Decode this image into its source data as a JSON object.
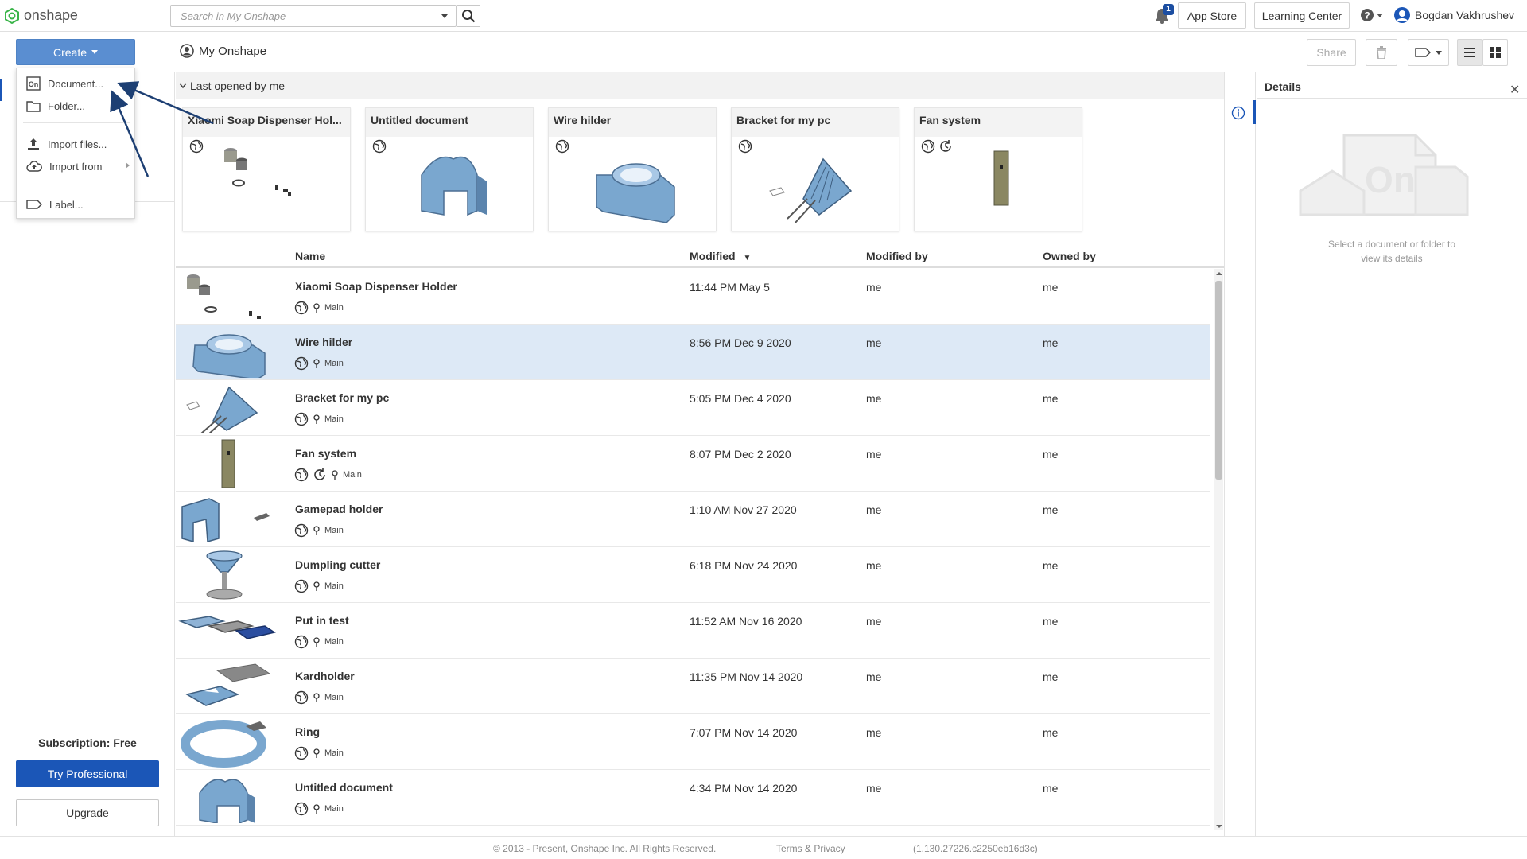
{
  "app": {
    "logo_text": "onshape"
  },
  "search": {
    "placeholder": "Search in My Onshape"
  },
  "notifications": {
    "count": "1"
  },
  "top_buttons": {
    "app_store": "App Store",
    "learning_center": "Learning Center"
  },
  "user": {
    "name": "Bogdan Vakhrushev"
  },
  "toolbar": {
    "create_label": "Create",
    "share_label": "Share"
  },
  "breadcrumb": {
    "label": "My Onshape"
  },
  "create_menu": [
    {
      "label": "Document...",
      "icon": "onshape-doc-icon"
    },
    {
      "label": "Folder...",
      "icon": "folder-icon"
    },
    {
      "label": "Import files...",
      "icon": "upload-icon"
    },
    {
      "label": "Import from",
      "icon": "cloud-upload-icon",
      "has_submenu": true
    },
    {
      "label": "Label...",
      "icon": "label-icon"
    }
  ],
  "recent": {
    "header": "Last opened by me",
    "cards": [
      {
        "title": "Xiaomi Soap Dispenser Hol...",
        "icons": [
          "globe"
        ]
      },
      {
        "title": "Untitled document",
        "icons": [
          "globe"
        ]
      },
      {
        "title": "Wire hilder",
        "icons": [
          "globe"
        ]
      },
      {
        "title": "Bracket for my pc",
        "icons": [
          "globe"
        ]
      },
      {
        "title": "Fan system",
        "icons": [
          "globe",
          "history"
        ]
      }
    ]
  },
  "table": {
    "columns": {
      "name": "Name",
      "modified": "Modified",
      "sort_indicator": "▼",
      "modified_by": "Modified by",
      "owned_by": "Owned by"
    },
    "rows": [
      {
        "name": "Xiaomi Soap Dispenser Holder",
        "branch": "Main",
        "modified": "11:44 PM May 5",
        "modified_by": "me",
        "owned_by": "me",
        "history": false,
        "selected": false
      },
      {
        "name": "Wire hilder",
        "branch": "Main",
        "modified": "8:56 PM Dec 9 2020",
        "modified_by": "me",
        "owned_by": "me",
        "history": false,
        "selected": true
      },
      {
        "name": "Bracket for my pc",
        "branch": "Main",
        "modified": "5:05 PM Dec 4 2020",
        "modified_by": "me",
        "owned_by": "me",
        "history": false,
        "selected": false
      },
      {
        "name": "Fan system",
        "branch": "Main",
        "modified": "8:07 PM Dec 2 2020",
        "modified_by": "me",
        "owned_by": "me",
        "history": true,
        "selected": false
      },
      {
        "name": "Gamepad holder",
        "branch": "Main",
        "modified": "1:10 AM Nov 27 2020",
        "modified_by": "me",
        "owned_by": "me",
        "history": false,
        "selected": false
      },
      {
        "name": "Dumpling cutter",
        "branch": "Main",
        "modified": "6:18 PM Nov 24 2020",
        "modified_by": "me",
        "owned_by": "me",
        "history": false,
        "selected": false
      },
      {
        "name": "Put in test",
        "branch": "Main",
        "modified": "11:52 AM Nov 16 2020",
        "modified_by": "me",
        "owned_by": "me",
        "history": false,
        "selected": false
      },
      {
        "name": "Kardholder",
        "branch": "Main",
        "modified": "11:35 PM Nov 14 2020",
        "modified_by": "me",
        "owned_by": "me",
        "history": false,
        "selected": false
      },
      {
        "name": "Ring",
        "branch": "Main",
        "modified": "7:07 PM Nov 14 2020",
        "modified_by": "me",
        "owned_by": "me",
        "history": false,
        "selected": false
      },
      {
        "name": "Untitled document",
        "branch": "Main",
        "modified": "4:34 PM Nov 14 2020",
        "modified_by": "me",
        "owned_by": "me",
        "history": false,
        "selected": false
      }
    ]
  },
  "sidebar": {
    "subscription": "Subscription: Free",
    "try_label": "Try Professional",
    "upgrade_label": "Upgrade"
  },
  "details": {
    "title": "Details",
    "empty_line1": "Select a document or folder to",
    "empty_line2": "view its details"
  },
  "footer": {
    "copyright": "© 2013 - Present, Onshape Inc. All Rights Reserved.",
    "terms": "Terms & Privacy",
    "version": "(1.130.27226.c2250eb16d3c)"
  },
  "colors": {
    "accent": "#1b56b7",
    "create_button": "#5a8ed1",
    "selected_row": "#dde9f6",
    "part_blue": "#7aa7cf"
  }
}
